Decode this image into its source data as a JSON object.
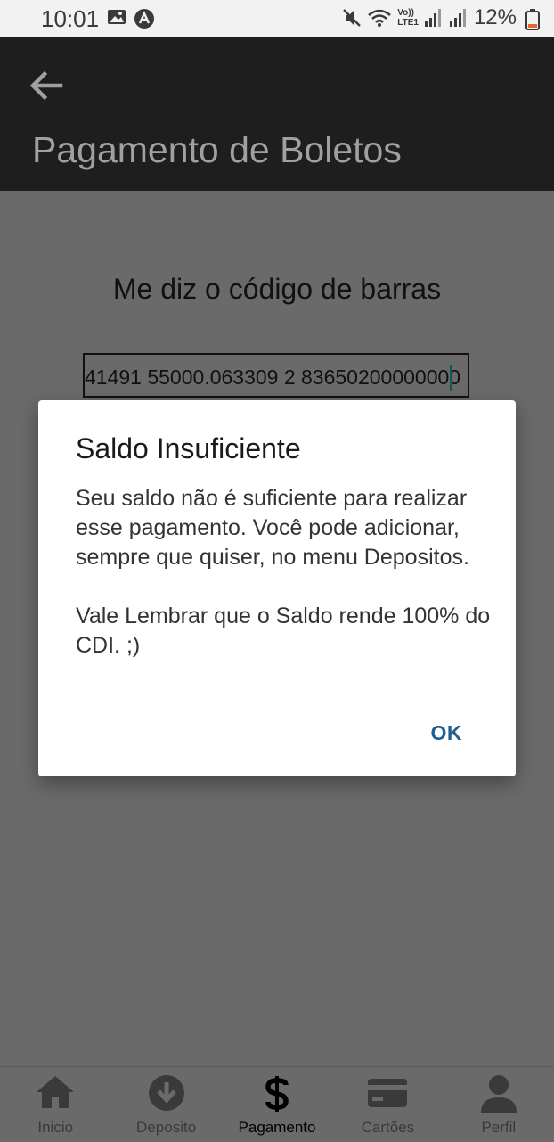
{
  "status_bar": {
    "time": "10:01",
    "battery_percent": "12%",
    "network_label_top": "Vo))",
    "network_label_bottom": "LTE1"
  },
  "app_bar": {
    "title": "Pagamento de Boletos",
    "back_icon": "arrow-left-icon"
  },
  "main": {
    "prompt": "Me diz o código de barras",
    "barcode_value": "41491 55000.063309 2 83650200000000"
  },
  "dialog": {
    "title": "Saldo Insuficiente",
    "message_1": "Seu saldo não é suficiente para realizar esse pagamento. Você pode adicionar, sempre que quiser, no menu Depositos.",
    "message_2": "Vale Lembrar que o Saldo rende 100% do CDI. ;)",
    "ok_label": "OK"
  },
  "bottom_nav": {
    "items": [
      {
        "label": "Inicio",
        "icon": "home-icon"
      },
      {
        "label": "Deposito",
        "icon": "download-circle-icon"
      },
      {
        "label": "Pagamento",
        "icon": "dollar-icon",
        "active": true
      },
      {
        "label": "Cartões",
        "icon": "credit-card-icon"
      },
      {
        "label": "Perfil",
        "icon": "person-icon"
      }
    ]
  },
  "colors": {
    "app_bar_bg": "#1e1e1e",
    "overlay_bg": "#6a6a6a",
    "dialog_button": "#1f5f8f",
    "battery_low": "#e8672e"
  }
}
